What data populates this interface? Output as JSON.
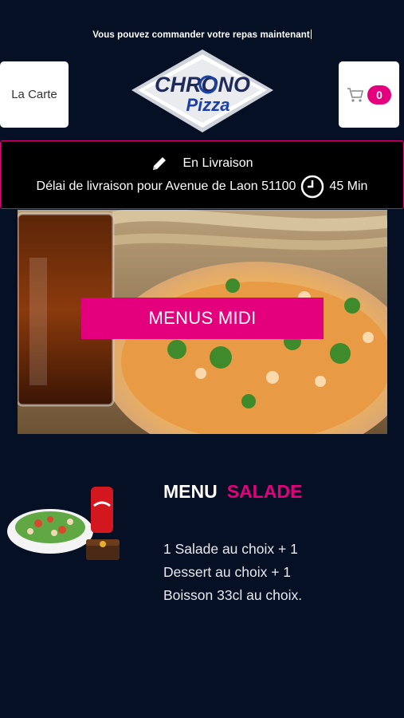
{
  "header": {
    "notice": "Vous pouvez commander votre repas maintenant",
    "menu_button": "La Carte",
    "cart_count": "0",
    "logo": {
      "line1": "CHRONO",
      "line2": "Pizza"
    }
  },
  "delivery": {
    "mode": "En Livraison",
    "delay_text": "Délai de livraison pour Avenue de Laon 51100",
    "delay_time": "45 Min"
  },
  "hero": {
    "button": "MENUS MIDI"
  },
  "menu": {
    "title_word1": "MENU",
    "title_word2": "SALADE",
    "description": "1 Salade au choix  + 1 Dessert au choix + 1 Boisson 33cl au choix."
  },
  "colors": {
    "background": "#061024",
    "accent": "#e4007c",
    "logo_blue": "#1b3fa8"
  }
}
